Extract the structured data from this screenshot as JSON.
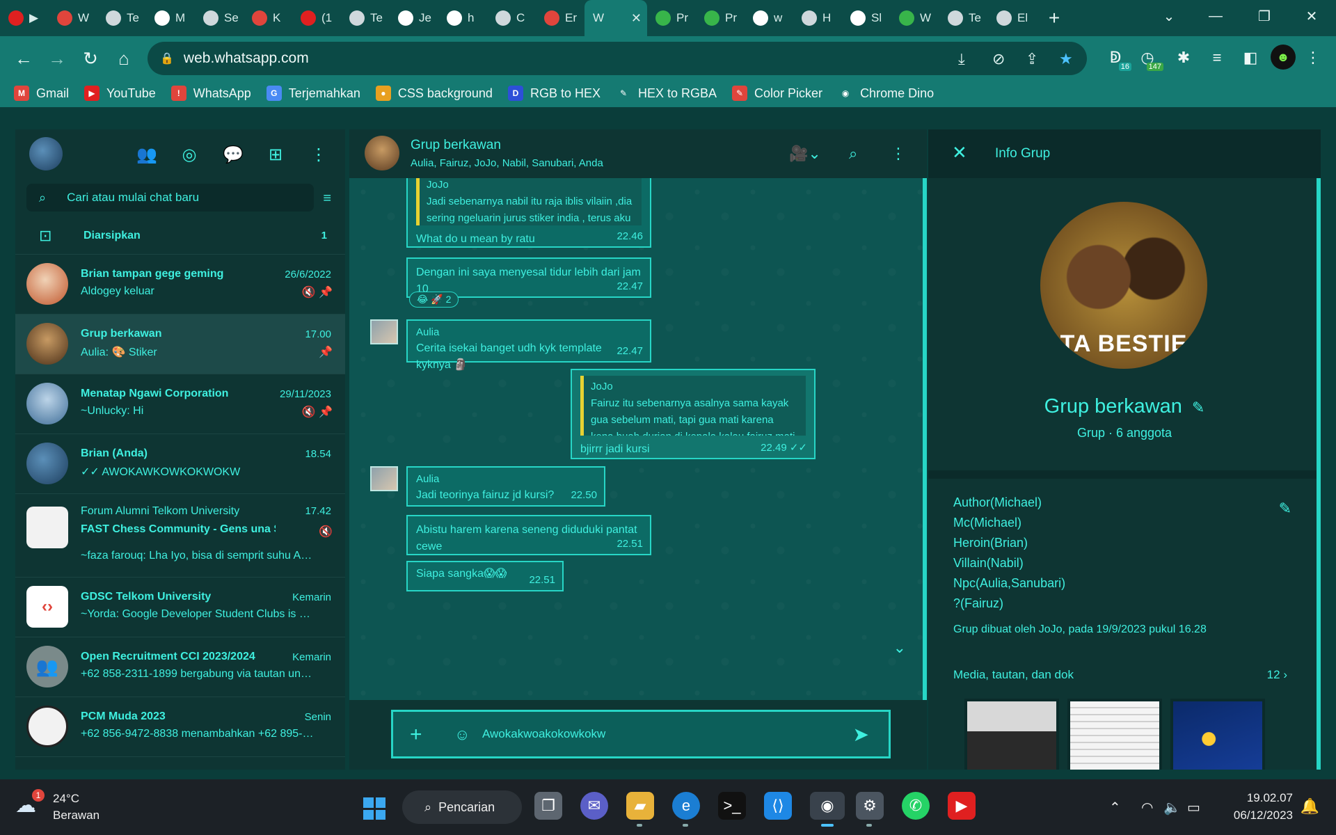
{
  "browser": {
    "tabs": [
      {
        "icon": "youtube-icon",
        "title": "▶",
        "color": "#e02020"
      },
      {
        "icon": "warning-icon",
        "title": "W",
        "color": "#e0453c"
      },
      {
        "icon": "chrome-icon",
        "title": "Te",
        "color": "#cfd8dc"
      },
      {
        "icon": "google-icon",
        "title": "M",
        "color": "#ffffff"
      },
      {
        "icon": "settings-icon",
        "title": "Se",
        "color": "#cfd8dc"
      },
      {
        "icon": "gmail-icon",
        "title": "K",
        "color": "#e0453c"
      },
      {
        "icon": "youtube-icon",
        "title": "(1",
        "color": "#e02020"
      },
      {
        "icon": "chrome-icon",
        "title": "Te",
        "color": "#cfd8dc"
      },
      {
        "icon": "google-icon",
        "title": "Je",
        "color": "#ffffff"
      },
      {
        "icon": "google-icon",
        "title": "h",
        "color": "#ffffff"
      },
      {
        "icon": "ck-icon",
        "title": "C",
        "color": "#cfd8dc"
      },
      {
        "icon": "pen-icon",
        "title": "Er",
        "color": "#e0453c"
      }
    ],
    "active_tab": {
      "title": "W",
      "close": "✕"
    },
    "tabs_right": [
      {
        "icon": "puzzle-color-icon",
        "title": "Pr",
        "color": "#38b54a"
      },
      {
        "icon": "puzzle-color-icon",
        "title": "Pr",
        "color": "#38b54a"
      },
      {
        "icon": "google-icon",
        "title": "w",
        "color": "#ffffff"
      },
      {
        "icon": "history-icon",
        "title": "H",
        "color": "#cfd8dc"
      },
      {
        "icon": "google-icon",
        "title": "Sl",
        "color": "#ffffff"
      },
      {
        "icon": "puzzle-color-icon",
        "title": "W",
        "color": "#38b54a"
      },
      {
        "icon": "chrome-icon",
        "title": "Te",
        "color": "#cfd8dc"
      },
      {
        "icon": "extension-icon",
        "title": "El",
        "color": "#cfd8dc"
      }
    ],
    "new_tab": "+",
    "url": "web.whatsapp.com",
    "extension_badges": {
      "first": "16",
      "second": "147"
    },
    "bookmarks": [
      {
        "label": "Gmail",
        "icon": "gmail-icon",
        "glyph": "M",
        "color": "#e0453c"
      },
      {
        "label": "YouTube",
        "icon": "youtube-icon",
        "glyph": "▶",
        "color": "#e02020"
      },
      {
        "label": "WhatsApp",
        "icon": "warning-icon",
        "glyph": "!",
        "color": "#e0453c"
      },
      {
        "label": "Terjemahkan",
        "icon": "translate-icon",
        "glyph": "G",
        "color": "#4a8af4"
      },
      {
        "label": "CSS background",
        "icon": "color-wheel-icon",
        "glyph": "●",
        "color": "#e8a020"
      },
      {
        "label": "RGB to HEX",
        "icon": "devtools-icon",
        "glyph": "D",
        "color": "#2d4fd8"
      },
      {
        "label": "HEX to RGBA",
        "icon": "eyedropper-icon",
        "glyph": "✎",
        "color": "#157a72"
      },
      {
        "label": "Color Picker",
        "icon": "color-picker-icon",
        "glyph": "✎",
        "color": "#e0453c"
      },
      {
        "label": "Chrome Dino",
        "icon": "globe-icon",
        "glyph": "◉",
        "color": "#157a72"
      }
    ]
  },
  "sidebar": {
    "search_placeholder": "Cari atau mulai chat baru",
    "archived": {
      "label": "Diarsipkan",
      "count": "1"
    },
    "chats": [
      {
        "name": "Brian tampan gege geming",
        "time": "26/6/2022",
        "message": "Aldogey keluar",
        "badges": "🔇 📌"
      },
      {
        "name": "Grup berkawan",
        "time": "17.00",
        "message": "Aulia: 🎨 Stiker",
        "badges": "📌"
      },
      {
        "name": "Menatap Ngawi Corporation",
        "time": "29/11/2023",
        "message": "~Unlucky: Hi",
        "badges": "🔇 📌"
      },
      {
        "name": "Brian (Anda)",
        "time": "18.54",
        "message": "✓✓ AWOKAWKOWKOKWOKW",
        "badges": ""
      }
    ],
    "community": {
      "parent": "Forum Alumni Telkom University",
      "time": "17.42",
      "name": "FAST Chess Community - Gens una Sumus",
      "message": "~faza farouq: Lha Iyo, bisa di semprit suhu Anas",
      "badges": "🔇"
    },
    "chats_bottom": [
      {
        "name": "GDSC Telkom University",
        "time": "Kemarin",
        "message": "~Yorda: Google Developer Student  Clubs is …"
      },
      {
        "name": "Open Recruitment CCI 2023/2024",
        "time": "Kemarin",
        "message": "+62 858-2311-1899 bergabung via tautan un…"
      },
      {
        "name": "PCM Muda 2023",
        "time": "Senin",
        "message": "+62 856-9472-8838 menambahkan +62 895-…"
      }
    ]
  },
  "chat": {
    "title": "Grup berkawan",
    "members": "Aulia, Fairuz, JoJo, Nabil, Sanubari, Anda",
    "msg1": {
      "quote_sender": "JoJo",
      "quote": "Jadi sebenarnya nabil itu raja iblis vilaiin ,dia sering ngeluarin jurus stiker india , terus aku berhasil bunuh dia dengan bantuan fairuz, setelah itu gua dinobatkan jadi …",
      "text": "What do u mean by ratu",
      "time": "22.46"
    },
    "msg2": {
      "text": "Dengan ini saya menyesal tidur lebih dari jam 10",
      "time": "22.47",
      "reaction": "😂 🚀 2"
    },
    "msg3": {
      "sender": "Aulia",
      "text": "Cerita isekai banget udh kyk template kyknya 🗿",
      "time": "22.47"
    },
    "msg4": {
      "quote_sender": "JoJo",
      "quote": "Fairuz itu sebenarnya asalnya  sama kayak gua sebelum mati, tapi gua mati karena kena buah durian di kepala,kalau fairuz mati karena kaget brutal pas nonton…",
      "text": "bjirrr jadi kursi",
      "time": "22.49 ✓✓"
    },
    "msg5": {
      "sender": "Aulia",
      "text": "Jadi teorinya fairuz jd kursi?",
      "time": "22.50"
    },
    "msg6": {
      "text": "Abistu harem karena seneng diduduki pantat cewe",
      "time": "22.51"
    },
    "msg7": {
      "text": "Siapa sangka😱😱",
      "time": "22.51"
    },
    "composer_text": "Awokakwoakokowkokw"
  },
  "info": {
    "header": "Info Grup",
    "photo_caption": "TA BESTIE",
    "group_name": "Grup berkawan",
    "meta": "Grup · 6 anggota",
    "description": [
      "Author(Michael)",
      "Mc(Michael)",
      "Heroin(Brian)",
      "Villain(Nabil)",
      "Npc(Aulia,Sanubari)",
      "?(Fairuz)"
    ],
    "created": "Grup dibuat oleh JoJo, pada 19/9/2023 pukul 16.28",
    "media_label": "Media, tautan, dan dok",
    "media_count": "12"
  },
  "taskbar": {
    "weather_badge": "1",
    "temperature": "24°C",
    "weather": "Berawan",
    "search": "Pencarian",
    "time": "19.02.07",
    "date": "06/12/2023"
  },
  "colors": {
    "accent": "#3ff0e0",
    "border": "#27d6c6",
    "bubble": "#0c6b65",
    "browser_tab_bar": "#0c4c48",
    "browser_toolbar": "#157a72"
  }
}
